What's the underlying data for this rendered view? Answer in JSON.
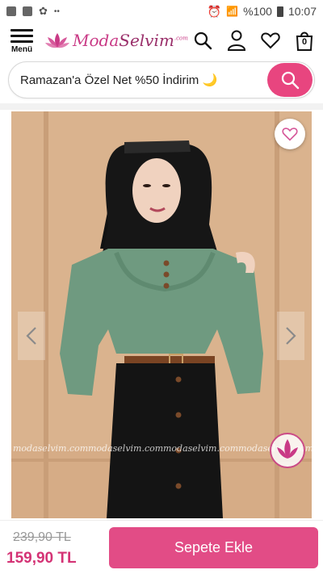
{
  "status_bar": {
    "battery": "%100",
    "time": "10:07",
    "dots": "••"
  },
  "header": {
    "menu_label": "Menü",
    "logo_moda": "Moda",
    "logo_selvim": "Selvim",
    "logo_com": ".com",
    "cart_count": "0"
  },
  "search": {
    "text": "Ramazan'a Özel Net %50 İndirim 🌙"
  },
  "product": {
    "watermark": "modaselvim.com"
  },
  "footer": {
    "old_price": "239,90 TL",
    "new_price": "159,90 TL",
    "add_to_cart": "Sepete Ekle"
  },
  "colors": {
    "brand": "#e24c86",
    "price": "#d43375",
    "search_button": "#e8457f"
  }
}
